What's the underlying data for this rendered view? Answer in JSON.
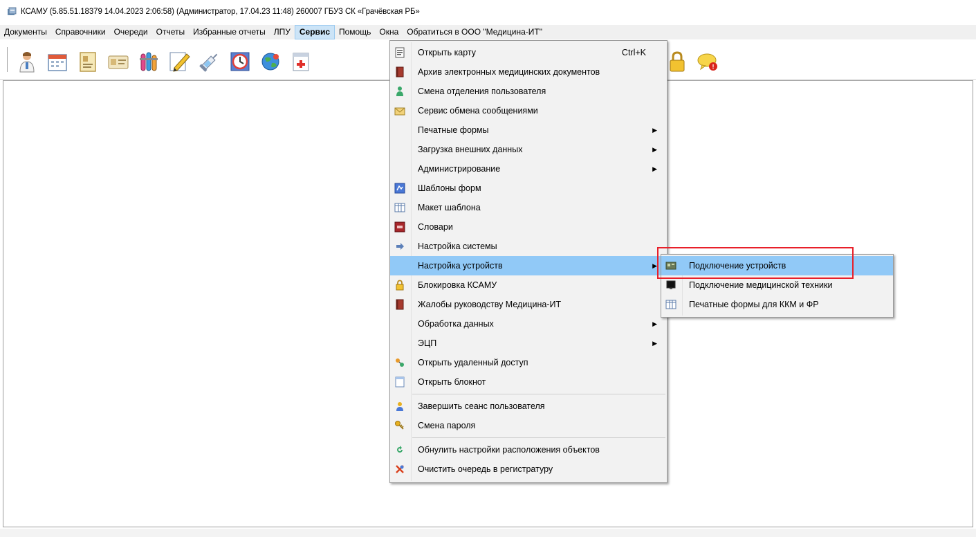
{
  "window": {
    "title": "КСАМУ (5.85.51.18379 14.04.2023 2:06:58) (Администратор, 17.04.23 11:48)  260007 ГБУЗ СК «Грачёвская РБ»"
  },
  "menubar": {
    "items": [
      {
        "label": "Документы"
      },
      {
        "label": "Справочники"
      },
      {
        "label": "Очереди"
      },
      {
        "label": "Отчеты"
      },
      {
        "label": "Избранные отчеты"
      },
      {
        "label": "ЛПУ"
      },
      {
        "label": "Сервис",
        "active": true
      },
      {
        "label": "Помощь"
      },
      {
        "label": "Окна"
      },
      {
        "label": "Обратиться в ООО \"Медицина-ИТ\""
      }
    ]
  },
  "toolbar": {
    "buttons": [
      {
        "icon": "doctor-icon"
      },
      {
        "icon": "calendar-icon"
      },
      {
        "icon": "card-icon"
      },
      {
        "icon": "id-card-icon"
      },
      {
        "icon": "flasks-icon"
      },
      {
        "icon": "pencil-icon"
      },
      {
        "icon": "syringe-icon"
      },
      {
        "icon": "clock-icon"
      },
      {
        "icon": "globe-icon"
      },
      {
        "icon": "medical-calendar-icon"
      },
      {
        "icon": "book-icon"
      },
      {
        "icon": "lock-icon"
      },
      {
        "icon": "chat-notification-icon"
      }
    ],
    "notification_badge": "!"
  },
  "service_menu": {
    "items": [
      {
        "label": "Открыть карту",
        "shortcut": "Ctrl+K",
        "icon": "card-icon"
      },
      {
        "label": "Архив электронных медицинских документов",
        "icon": "archive-book-icon"
      },
      {
        "label": "Смена отделения пользователя",
        "icon": "user-switch-icon"
      },
      {
        "label": "Сервис обмена сообщениями",
        "icon": "envelope-icon"
      },
      {
        "label": "Печатные формы",
        "submenu": true
      },
      {
        "label": "Загрузка внешних данных",
        "submenu": true
      },
      {
        "label": "Администрирование",
        "submenu": true
      },
      {
        "label": "Шаблоны форм",
        "icon": "template-icon"
      },
      {
        "label": "Макет шаблона",
        "icon": "layout-icon"
      },
      {
        "label": "Словари",
        "icon": "dictionary-icon"
      },
      {
        "label": "Настройка системы",
        "icon": "arrow-right-icon"
      },
      {
        "label": "Настройка устройств",
        "submenu": true,
        "highlighted": true
      },
      {
        "label": "Блокировка КСАМУ",
        "icon": "lock-icon"
      },
      {
        "label": "Жалобы руководству Медицина-ИТ",
        "icon": "complaint-book-icon"
      },
      {
        "label": "Обработка данных",
        "submenu": true
      },
      {
        "label": "ЭЦП",
        "submenu": true
      },
      {
        "label": "Открыть удаленный доступ",
        "icon": "remote-access-icon"
      },
      {
        "label": "Открыть блокнот",
        "icon": "notepad-icon"
      },
      {
        "label": "Завершить сеанс пользователя",
        "icon": "logout-user-icon",
        "separator_before": true
      },
      {
        "label": "Смена пароля",
        "icon": "key-icon"
      },
      {
        "label": "Обнулить настройки расположения объектов",
        "icon": "reset-icon",
        "separator_before": true
      },
      {
        "label": "Очистить очередь в регистратуру",
        "icon": "clear-queue-icon"
      }
    ],
    "arrow_glyph": "▶"
  },
  "devices_submenu": {
    "items": [
      {
        "label": "Подключение устройств",
        "icon": "device-icon",
        "highlighted": true
      },
      {
        "label": "Подключение медицинской техники",
        "icon": "monitor-icon"
      },
      {
        "label": "Печатные формы для ККМ и ФР",
        "icon": "table-icon"
      }
    ]
  },
  "colors": {
    "highlight": "#91c9f7",
    "annotation_box": "#e8202a",
    "menu_bg": "#f2f2f2"
  }
}
